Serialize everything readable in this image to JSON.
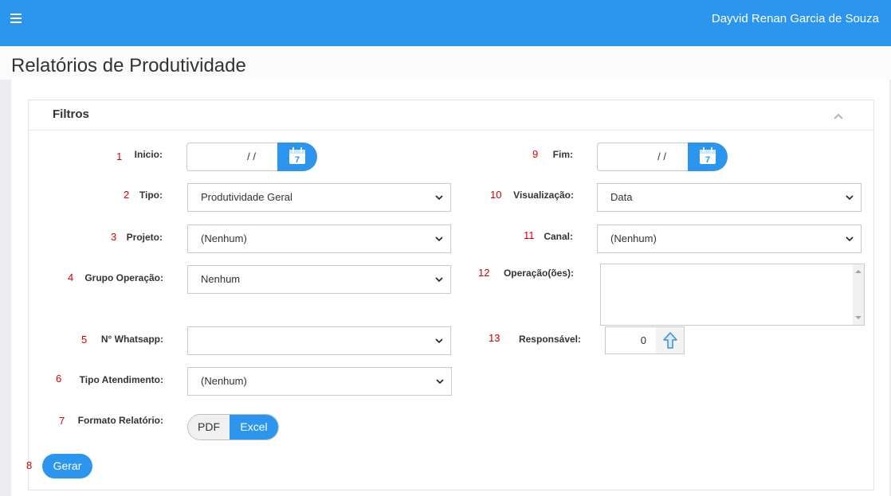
{
  "header": {
    "user_name": "Dayvid Renan Garcia de Souza",
    "menu_icon": "hamburger-icon",
    "accent_color": "#2c96ee"
  },
  "page": {
    "title": "Relatórios de Produtividade"
  },
  "panel": {
    "title": "Filtros",
    "collapse_icon": "chevron-up-icon"
  },
  "fields": {
    "inicio": {
      "num": "1",
      "label": "Inicio:",
      "value": "/ /",
      "icon": "calendar-icon",
      "calendar_day": "7"
    },
    "tipo": {
      "num": "2",
      "label": "Tipo:",
      "value": "Produtividade Geral"
    },
    "projeto": {
      "num": "3",
      "label": "Projeto:",
      "value": "(Nenhum)"
    },
    "grupo_operacao": {
      "num": "4",
      "label": "Grupo Operação:",
      "value": "Nenhum"
    },
    "whatsapp": {
      "num": "5",
      "label": "N° Whatsapp:",
      "value": ""
    },
    "tipo_atendimento": {
      "num": "6",
      "label": "Tipo Atendimento:",
      "value": "(Nenhum)"
    },
    "formato": {
      "num": "7",
      "label": "Formato Relatório:",
      "options": [
        "PDF",
        "Excel"
      ],
      "selected": "Excel"
    },
    "gerar": {
      "num": "8",
      "label": "Gerar"
    },
    "fim": {
      "num": "9",
      "label": "Fim:",
      "value": "/ /",
      "icon": "calendar-icon",
      "calendar_day": "7"
    },
    "visualizacao": {
      "num": "10",
      "label": "Visualização:",
      "value": "Data"
    },
    "canal": {
      "num": "11",
      "label": "Canal:",
      "value": "(Nenhum)"
    },
    "operacoes": {
      "num": "12",
      "label": "Operação(ões):",
      "value": ""
    },
    "responsavel": {
      "num": "13",
      "label": "Responsável:",
      "value": "0",
      "icon": "arrow-up-icon"
    }
  }
}
